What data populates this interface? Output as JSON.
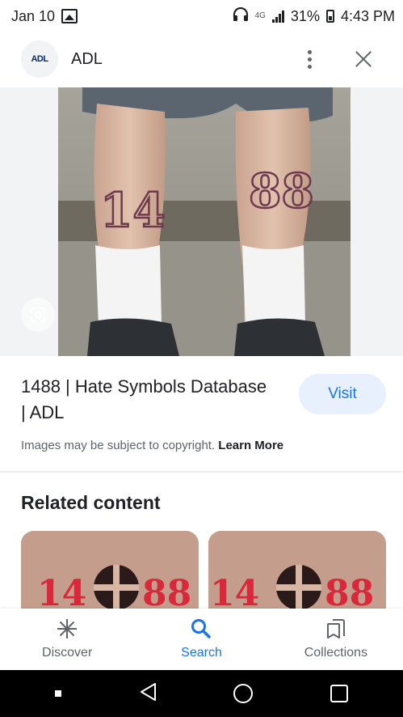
{
  "status_bar": {
    "date": "Jan 10",
    "network": "4G",
    "battery": "31%",
    "time": "4:43 PM"
  },
  "header": {
    "logo_text": "ADL",
    "site_name": "ADL"
  },
  "image": {
    "tattoo_left": "14",
    "tattoo_right": "88"
  },
  "result": {
    "title": "1488 | Hate Symbols Database | ADL",
    "visit_label": "Visit",
    "copyright_text": "Images may be subject to copyright.",
    "learn_more_label": "Learn More"
  },
  "related": {
    "title": "Related content"
  },
  "bottom_nav": {
    "items": [
      {
        "label": "Discover",
        "icon": "asterisk-icon"
      },
      {
        "label": "Search",
        "icon": "search-icon"
      },
      {
        "label": "Collections",
        "icon": "bookmarks-icon"
      }
    ],
    "active": "Search"
  },
  "colors": {
    "accent": "#1a73e8",
    "visit_bg": "#e8f0fe"
  }
}
